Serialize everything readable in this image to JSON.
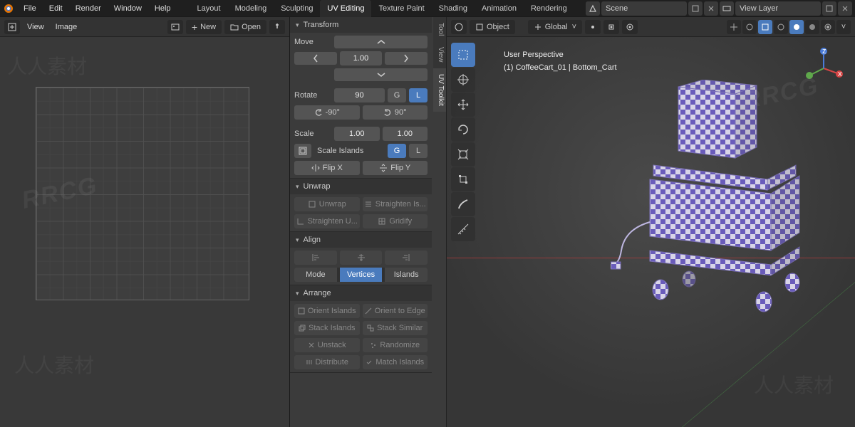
{
  "menu": [
    "File",
    "Edit",
    "Render",
    "Window",
    "Help"
  ],
  "workspaces": [
    "Layout",
    "Modeling",
    "Sculpting",
    "UV Editing",
    "Texture Paint",
    "Shading",
    "Animation",
    "Rendering"
  ],
  "active_workspace": "UV Editing",
  "scene_field": "Scene",
  "viewlayer_field": "View Layer",
  "left_header": {
    "view": "View",
    "image": "Image",
    "new": "New",
    "open": "Open"
  },
  "mid_tabs": [
    "Tool",
    "View",
    "UV Toolkit"
  ],
  "transform": {
    "title": "Transform",
    "move_label": "Move",
    "move_value": "1.00",
    "rotate_label": "Rotate",
    "rotate_value": "90",
    "rot_neg": "-90°",
    "rot_pos": "90°",
    "scale_label": "Scale",
    "scale_a": "1.00",
    "scale_b": "1.00",
    "scale_islands": "Scale Islands",
    "flipx": "Flip X",
    "flipy": "Flip Y",
    "g": "G",
    "l": "L"
  },
  "unwrap": {
    "title": "Unwrap",
    "unwrap_btn": "Unwrap",
    "str_is": "Straighten Is...",
    "str_u": "Straighten U...",
    "grid": "Gridify"
  },
  "align": {
    "title": "Align",
    "mode": "Mode",
    "verts": "Vertices",
    "islands": "Islands"
  },
  "arrange": {
    "title": "Arrange",
    "orient_is": "Orient Islands",
    "orient_ed": "Orient to Edge",
    "stack_is": "Stack Islands",
    "stack_sim": "Stack Similar",
    "unstack": "Unstack",
    "random": "Randomize",
    "dist": "Distribute",
    "match": "Match Islands"
  },
  "right_header": {
    "mode": "Object",
    "orientation": "Global"
  },
  "overlay": {
    "persp": "User Perspective",
    "obj": "(1) CoffeeCart_01 | Bottom_Cart"
  },
  "colors": {
    "accent": "#4a7bbd",
    "axis_x": "#d64545",
    "axis_y": "#5fa84b",
    "axis_z": "#4a7bd8"
  },
  "watermark_en": "RRCG",
  "watermark_cn": "人人素材"
}
